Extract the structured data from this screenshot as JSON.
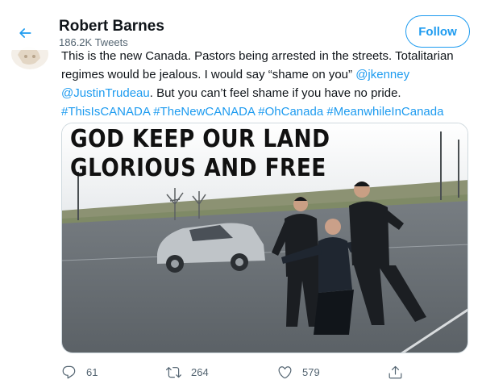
{
  "header": {
    "name": "Robert Barnes",
    "tweet_count": "186.2K Tweets",
    "follow_label": "Follow",
    "back_icon": "back-arrow-icon"
  },
  "tweet": {
    "text_plain": "This is the new Canada. Pastors being arrested in the streets. Totalitarian regimes would be jealous. I would say “shame on you” ",
    "mention_1": "@jkenney",
    "mention_2": "@JustinTrudeau",
    "text_after": ". But you can’t feel shame if you have no pride.",
    "hashtags": [
      "#ThisIsCANADA",
      "#TheNewCANADA",
      "#OhCanada",
      "#MeanwhileInCanada"
    ],
    "media": {
      "overlay_line_1": "GOD KEEP OUR LAND",
      "overlay_line_2": "GLORIOUS AND FREE"
    }
  },
  "actions": {
    "reply": {
      "icon": "reply-icon",
      "count": "61"
    },
    "retweet": {
      "icon": "retweet-icon",
      "count": "264"
    },
    "like": {
      "icon": "heart-icon",
      "count": "579"
    },
    "share": {
      "icon": "share-icon"
    }
  },
  "colors": {
    "accent": "#1d9bf0",
    "text": "#0f1419",
    "secondary": "#536471",
    "border": "#cfd9de"
  }
}
